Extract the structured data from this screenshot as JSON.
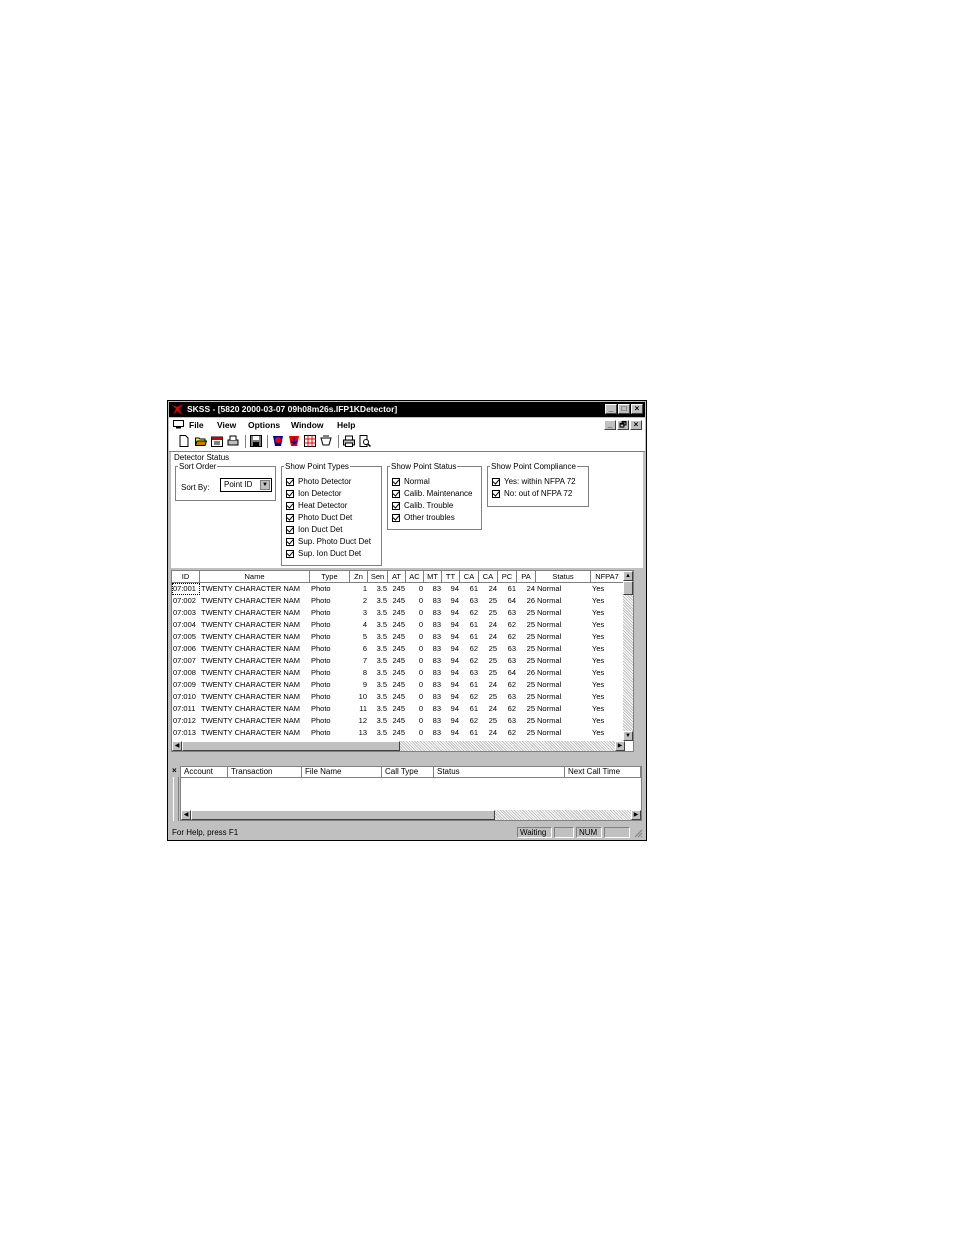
{
  "window": {
    "title": "SKSS - [5820 2000-03-07 09h08m26s.IFP1KDetector]",
    "controls": [
      "_",
      "□",
      "×"
    ]
  },
  "menubar": {
    "items": [
      "File",
      "View",
      "Options",
      "Window",
      "Help"
    ],
    "mdi_controls": [
      "_",
      "🗗",
      "×"
    ]
  },
  "toolbar": {
    "icons": [
      "new-icon",
      "open-icon",
      "calendar-icon",
      "print-setup-icon",
      "save-icon",
      "detector-red-icon",
      "detector-down-icon",
      "grid-red-icon",
      "detector-flag-icon",
      "print-icon",
      "print-preview-icon"
    ]
  },
  "panel": {
    "title": "Detector Status",
    "sort_order": {
      "legend": "Sort Order",
      "label": "Sort By:",
      "value": "Point ID"
    },
    "point_types": {
      "legend": "Show Point Types",
      "items": [
        "Photo Detector",
        "Ion Detector",
        "Heat Detector",
        "Photo Duct Det",
        "Ion Duct Det",
        "Sup. Photo Duct Det",
        "Sup. Ion Duct Det"
      ]
    },
    "point_status": {
      "legend": "Show Point Status",
      "items": [
        "Normal",
        "Calib. Maintenance",
        "Calib. Trouble",
        "Other troubles"
      ]
    },
    "point_compliance": {
      "legend": "Show Point Compliance",
      "items": [
        "Yes: within NFPA 72",
        "No: out of NFPA 72"
      ]
    }
  },
  "grid": {
    "columns": [
      "ID",
      "Name",
      "Type",
      "Zn",
      "Sen",
      "AT",
      "AC",
      "MT",
      "TT",
      "CA",
      "CA",
      "PC",
      "PA",
      "Status",
      "NFPA7"
    ],
    "rows": [
      [
        "07:001",
        "TWENTY CHARACTER NAM",
        "Photo",
        "1",
        "3.5",
        "245",
        "0",
        "83",
        "94",
        "61",
        "24",
        "61",
        "24",
        "Normal",
        "Yes"
      ],
      [
        "07:002",
        "TWENTY CHARACTER NAM",
        "Photo",
        "2",
        "3.5",
        "245",
        "0",
        "83",
        "94",
        "63",
        "25",
        "64",
        "26",
        "Normal",
        "Yes"
      ],
      [
        "07:003",
        "TWENTY CHARACTER NAM",
        "Photo",
        "3",
        "3.5",
        "245",
        "0",
        "83",
        "94",
        "62",
        "25",
        "63",
        "25",
        "Normal",
        "Yes"
      ],
      [
        "07:004",
        "TWENTY CHARACTER NAM",
        "Photo",
        "4",
        "3.5",
        "245",
        "0",
        "83",
        "94",
        "61",
        "24",
        "62",
        "25",
        "Normal",
        "Yes"
      ],
      [
        "07:005",
        "TWENTY CHARACTER NAM",
        "Photo",
        "5",
        "3.5",
        "245",
        "0",
        "83",
        "94",
        "61",
        "24",
        "62",
        "25",
        "Normal",
        "Yes"
      ],
      [
        "07:006",
        "TWENTY CHARACTER NAM",
        "Photo",
        "6",
        "3.5",
        "245",
        "0",
        "83",
        "94",
        "62",
        "25",
        "63",
        "25",
        "Normal",
        "Yes"
      ],
      [
        "07:007",
        "TWENTY CHARACTER NAM",
        "Photo",
        "7",
        "3.5",
        "245",
        "0",
        "83",
        "94",
        "62",
        "25",
        "63",
        "25",
        "Normal",
        "Yes"
      ],
      [
        "07:008",
        "TWENTY CHARACTER NAM",
        "Photo",
        "8",
        "3.5",
        "245",
        "0",
        "83",
        "94",
        "63",
        "25",
        "64",
        "26",
        "Normal",
        "Yes"
      ],
      [
        "07:009",
        "TWENTY CHARACTER NAM",
        "Photo",
        "9",
        "3.5",
        "245",
        "0",
        "83",
        "94",
        "61",
        "24",
        "62",
        "25",
        "Normal",
        "Yes"
      ],
      [
        "07:010",
        "TWENTY CHARACTER NAM",
        "Photo",
        "10",
        "3.5",
        "245",
        "0",
        "83",
        "94",
        "62",
        "25",
        "63",
        "25",
        "Normal",
        "Yes"
      ],
      [
        "07:011",
        "TWENTY CHARACTER NAM",
        "Photo",
        "11",
        "3.5",
        "245",
        "0",
        "83",
        "94",
        "61",
        "24",
        "62",
        "25",
        "Normal",
        "Yes"
      ],
      [
        "07:012",
        "TWENTY CHARACTER NAM",
        "Photo",
        "12",
        "3.5",
        "245",
        "0",
        "83",
        "94",
        "62",
        "25",
        "63",
        "25",
        "Normal",
        "Yes"
      ],
      [
        "07:013",
        "TWENTY CHARACTER NAM",
        "Photo",
        "13",
        "3.5",
        "245",
        "0",
        "83",
        "94",
        "61",
        "24",
        "62",
        "25",
        "Normal",
        "Yes"
      ]
    ]
  },
  "call_list": {
    "close": "×",
    "columns": [
      "Account",
      "Transaction",
      "File Name",
      "Call Type",
      "Status",
      "Next Call Time"
    ]
  },
  "statusbar": {
    "help": "For Help, press F1",
    "state": "Waiting",
    "num": "NUM"
  }
}
